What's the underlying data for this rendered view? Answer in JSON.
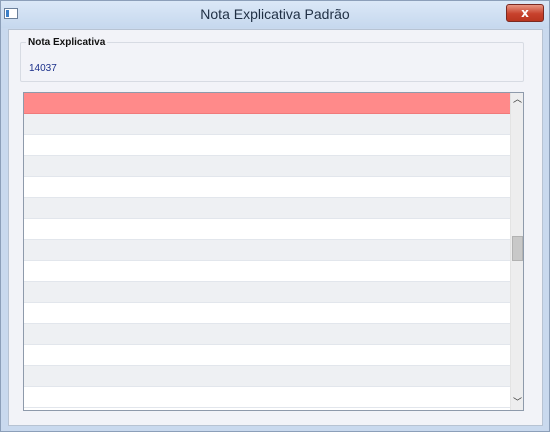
{
  "window": {
    "title": "Nota Explicativa Padrão",
    "close_label": "x"
  },
  "nota": {
    "label": "Nota Explicativa",
    "value": "14037"
  },
  "grid": {
    "selected_row_color": "#ff8a8a",
    "row_count": 15,
    "scroll_up_icon": "chevron-up",
    "scroll_down_icon": "chevron-down"
  }
}
